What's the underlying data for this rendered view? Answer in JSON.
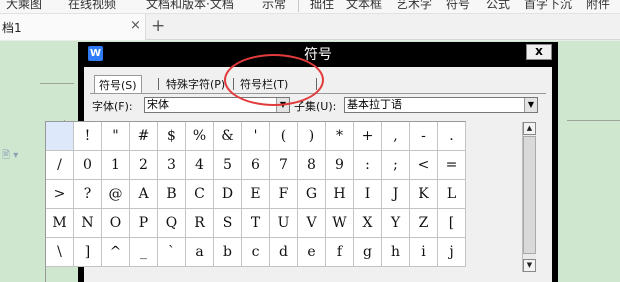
{
  "topbar": {
    "items": [
      "大乘图",
      "在线视频",
      "文档和版本·文档",
      "示常",
      "拙住",
      "文本框",
      "艺术字",
      "符号",
      "公式",
      "首字下沉",
      "附件"
    ]
  },
  "tabs": {
    "doc_title": "档1",
    "close_glyph": "×",
    "new_glyph": "+"
  },
  "side_icon": "🖹 ▾",
  "dialog": {
    "logo": "W",
    "title": "符号",
    "close": "x",
    "tabs": [
      {
        "label": "符号(S)",
        "active": true
      },
      {
        "label": "特殊字符(P)",
        "active": false
      },
      {
        "label": "符号栏(T)",
        "active": false
      }
    ],
    "font_label": "字体(F):",
    "font_value": "宋体",
    "subset_label": "子集(U):",
    "subset_value": "基本拉丁语",
    "dropdown_arrow": "▼"
  },
  "symbols": [
    [
      "",
      "!",
      "\"",
      "#",
      "$",
      "%",
      "&",
      "'",
      "(",
      ")",
      "*",
      "+",
      ",",
      "-",
      "."
    ],
    [
      "/",
      "0",
      "1",
      "2",
      "3",
      "4",
      "5",
      "6",
      "7",
      "8",
      "9",
      ":",
      ";",
      "<",
      "="
    ],
    [
      ">",
      "?",
      "@",
      "A",
      "B",
      "C",
      "D",
      "E",
      "F",
      "G",
      "H",
      "I",
      "J",
      "K",
      "L"
    ],
    [
      "M",
      "N",
      "O",
      "P",
      "Q",
      "R",
      "S",
      "T",
      "U",
      "V",
      "W",
      "X",
      "Y",
      "Z",
      "["
    ],
    [
      "\\",
      "]",
      "^",
      "_",
      "`",
      "a",
      "b",
      "c",
      "d",
      "e",
      "f",
      "g",
      "h",
      "i",
      "j"
    ]
  ],
  "scrollbar": {
    "up": "▲",
    "down": "▼"
  },
  "accent": {
    "logo_blue": "#2f7cf6",
    "annotation_red": "#e23b3b",
    "doc_green": "#cfe7cf"
  }
}
